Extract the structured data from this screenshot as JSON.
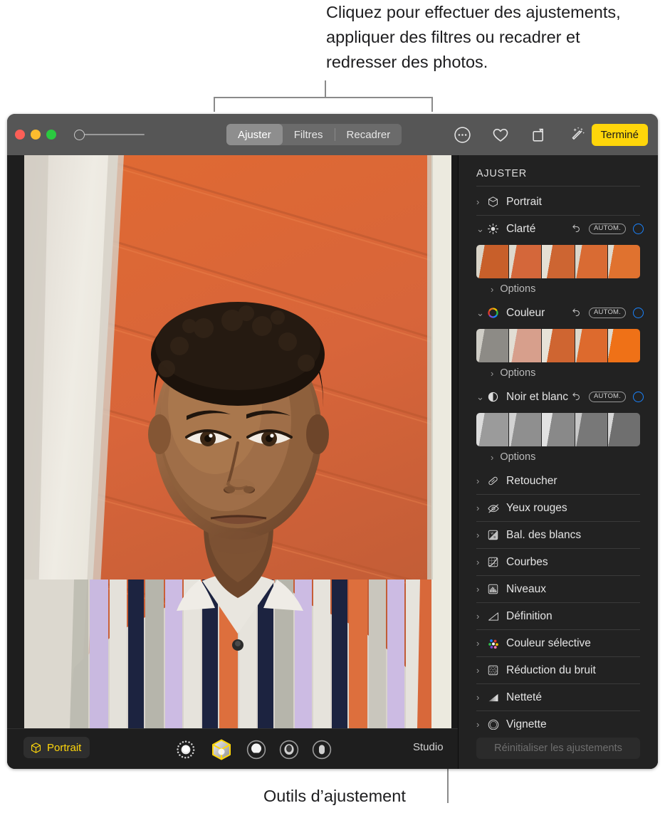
{
  "callouts": {
    "top": "Cliquez pour effectuer des ajustements, appliquer des filtres ou recadrer et redresser des photos.",
    "bottom": "Outils d’ajustement"
  },
  "window": {
    "titlebar": {
      "traffic_lights": [
        "close-red",
        "minimize-yellow",
        "zoom-green"
      ],
      "zoom_slider_value": 0,
      "segmented": [
        {
          "label": "Ajuster",
          "active": true
        },
        {
          "label": "Filtres",
          "active": false
        },
        {
          "label": "Recadrer",
          "active": false
        }
      ],
      "icons": [
        {
          "name": "more-options-icon",
          "glyph": "ellipsis-circle"
        },
        {
          "name": "favorite-heart-icon",
          "glyph": "heart"
        },
        {
          "name": "rotate-icon",
          "glyph": "rotate"
        },
        {
          "name": "auto-enhance-icon",
          "glyph": "magic-wand"
        }
      ],
      "done_label": "Terminé"
    },
    "bottom_bar": {
      "portrait_chip": "Portrait",
      "lighting_effects": [
        "natural-light-icon",
        "studio-light-icon",
        "contour-light-icon",
        "stage-light-icon",
        "stage-light-mono-icon"
      ],
      "active_lighting_index": 1,
      "mode_label": "Studio"
    },
    "sidebar": {
      "title": "AJUSTER",
      "reset_button": "Réinitialiser les ajustements",
      "options_label": "Options",
      "auto_badge": "AUTOM.",
      "items": [
        {
          "label": "Portrait",
          "icon": "cube-icon",
          "expanded": false,
          "has_controls": false
        },
        {
          "label": "Clarté",
          "icon": "brightness-icon",
          "expanded": true,
          "has_controls": true,
          "thumbs": "clarity"
        },
        {
          "label": "Couleur",
          "icon": "color-wheel-icon",
          "expanded": true,
          "has_controls": true,
          "thumbs": "color"
        },
        {
          "label": "Noir et blanc",
          "icon": "half-circle-icon",
          "expanded": true,
          "has_controls": true,
          "thumbs": "bw"
        },
        {
          "label": "Retoucher",
          "icon": "bandage-icon",
          "expanded": false,
          "has_controls": false
        },
        {
          "label": "Yeux rouges",
          "icon": "eye-slash-icon",
          "expanded": false,
          "has_controls": false
        },
        {
          "label": "Bal. des blancs",
          "icon": "white-balance-icon",
          "expanded": false,
          "has_controls": false
        },
        {
          "label": "Courbes",
          "icon": "curves-icon",
          "expanded": false,
          "has_controls": false
        },
        {
          "label": "Niveaux",
          "icon": "levels-icon",
          "expanded": false,
          "has_controls": false
        },
        {
          "label": "Définition",
          "icon": "definition-icon",
          "expanded": false,
          "has_controls": false
        },
        {
          "label": "Couleur sélective",
          "icon": "selective-color-icon",
          "expanded": false,
          "has_controls": false
        },
        {
          "label": "Réduction du bruit",
          "icon": "noise-reduction-icon",
          "expanded": false,
          "has_controls": false
        },
        {
          "label": "Netteté",
          "icon": "sharpen-icon",
          "expanded": false,
          "has_controls": false
        },
        {
          "label": "Vignette",
          "icon": "vignette-icon",
          "expanded": false,
          "has_controls": false
        }
      ]
    }
  },
  "colors": {
    "accent_yellow": "#ffd60a",
    "accent_blue": "#1a84ff",
    "titlebar": "#565656",
    "sidebar_bg": "#222222",
    "window_bg": "#1e1e1e",
    "photo_wall": "#e2743c"
  }
}
